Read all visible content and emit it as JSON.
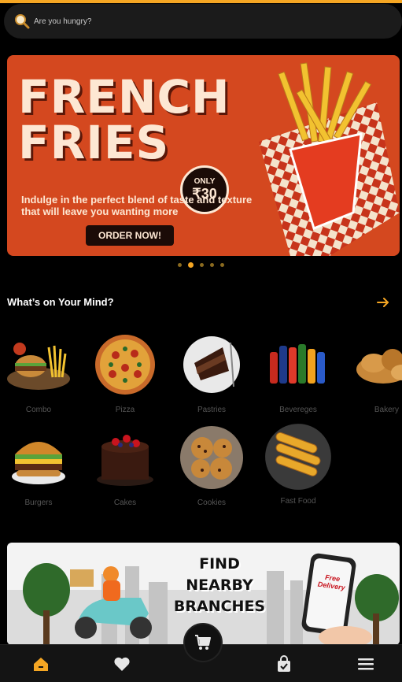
{
  "search": {
    "placeholder": "Are you hungry?"
  },
  "banner": {
    "title_line1": "FRENCH",
    "title_line2": "FRIES",
    "price_prefix": "ONLY",
    "price_amount": "₹30",
    "description": "Indulge in the perfect blend of taste and texture that will leave you wanting more",
    "cta_label": "ORDER NOW!",
    "slide_count": 5,
    "active_slide": 2
  },
  "categories_section": {
    "title": "What’s on Your Mind?"
  },
  "categories": [
    {
      "label": "Combo"
    },
    {
      "label": "Pizza"
    },
    {
      "label": "Pastries"
    },
    {
      "label": "Bevereges"
    },
    {
      "label": "Bakery"
    },
    {
      "label": "Burgers"
    },
    {
      "label": "Cakes"
    },
    {
      "label": "Cookies"
    },
    {
      "label": "Fast Food"
    }
  ],
  "promo": {
    "line1": "FIND",
    "line2": "NEARBY",
    "line3": "BRANCHES",
    "phone_text_1": "Free",
    "phone_text_2": "Delivery"
  },
  "nav": {
    "items": [
      "home-icon",
      "heart-icon",
      "shopping-bag-icon",
      "menu-icon"
    ],
    "active": "home-icon"
  },
  "colors": {
    "accent": "#f5a623",
    "background": "#000000",
    "banner_bg": "#d4481f"
  }
}
